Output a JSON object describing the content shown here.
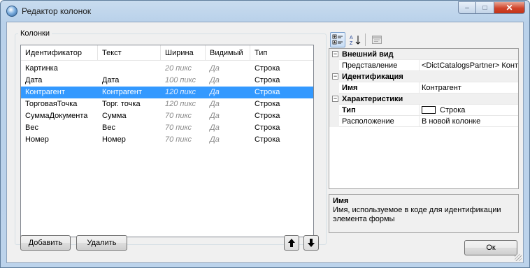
{
  "window": {
    "title": "Редактор колонок",
    "caption": {
      "minimize": "–",
      "maximize": "□",
      "close": "✕"
    }
  },
  "group": {
    "label": "Колонки"
  },
  "columns_list": {
    "headers": [
      "Идентификатор",
      "Текст",
      "Ширина",
      "Видимый",
      "Тип"
    ],
    "rows": [
      {
        "id": "Картинка",
        "text": "",
        "width": "20 пикс",
        "visible": "Да",
        "type": "Строка",
        "selected": false
      },
      {
        "id": "Дата",
        "text": "Дата",
        "width": "100 пикс",
        "visible": "Да",
        "type": "Строка",
        "selected": false
      },
      {
        "id": "Контрагент",
        "text": "Контрагент",
        "width": "120 пикс",
        "visible": "Да",
        "type": "Строка",
        "selected": true
      },
      {
        "id": "ТорговаяТочка",
        "text": "Торг. точка",
        "width": "120 пикс",
        "visible": "Да",
        "type": "Строка",
        "selected": false
      },
      {
        "id": "СуммаДокумента",
        "text": "Сумма",
        "width": "70 пикс",
        "visible": "Да",
        "type": "Строка",
        "selected": false
      },
      {
        "id": "Вес",
        "text": "Вес",
        "width": "70 пикс",
        "visible": "Да",
        "type": "Строка",
        "selected": false
      },
      {
        "id": "Номер",
        "text": "Номер",
        "width": "70 пикс",
        "visible": "Да",
        "type": "Строка",
        "selected": false
      }
    ]
  },
  "buttons": {
    "add": "Добавить",
    "delete": "Удалить",
    "ok": "Ок"
  },
  "properties": {
    "sections": [
      {
        "label": "Внешний вид",
        "props": [
          {
            "name": "Представление",
            "value": "<DictCatalogsPartner> Контрагент",
            "bold": false
          }
        ]
      },
      {
        "label": "Идентификация",
        "props": [
          {
            "name": "Имя",
            "value": "Контрагент",
            "bold": true
          }
        ]
      },
      {
        "label": "Характеристики",
        "props": [
          {
            "name": "Тип",
            "value": "Строка",
            "bold": true
          },
          {
            "name": "Расположение",
            "value": "В новой колонке",
            "bold": false
          }
        ]
      }
    ],
    "expander": "−"
  },
  "description": {
    "title": "Имя",
    "text": "Имя, используемое в коде для идентификации элемента формы"
  },
  "colors": {
    "selection": "#3399ff",
    "frame": "#bcd3eb"
  }
}
